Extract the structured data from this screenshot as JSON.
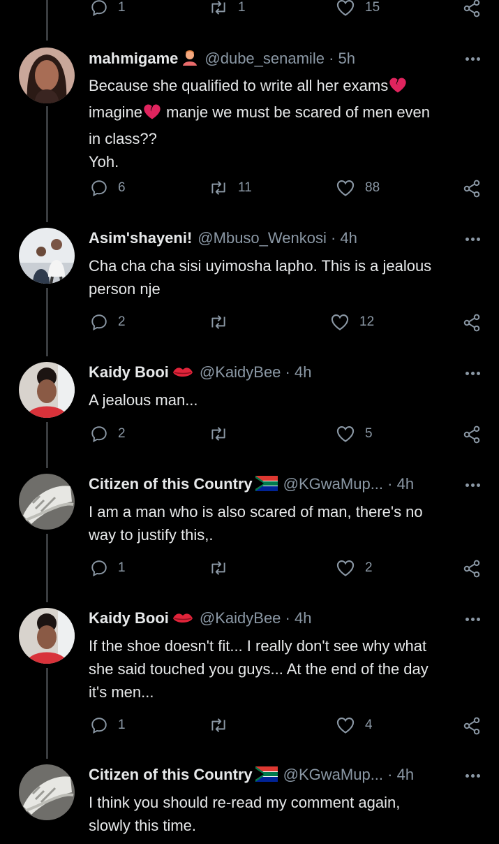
{
  "top_actions": {
    "replies": "1",
    "retweets": "1",
    "likes": "15"
  },
  "tweets": [
    {
      "name": "mahmigame",
      "handle": "@dube_senamile",
      "time": "· 5h",
      "lines": [
        "Because she qualified to write all her exams",
        "imagine",
        "manje we must be scared of men even",
        "in class??",
        "Yoh."
      ],
      "replies": "6",
      "retweets": "11",
      "likes": "88",
      "avatar": "woman-portrait"
    },
    {
      "name": "Asim'shayeni!",
      "handle": "@Mbuso_Wenkosi",
      "time": "· 4h",
      "lines": [
        "Cha cha cha sisi uyimosha lapho. This is a jealous",
        "person nje"
      ],
      "replies": "2",
      "retweets": "",
      "likes": "12",
      "avatar": "group-photo"
    },
    {
      "name": "Kaidy Booi",
      "handle": "@KaidyBee",
      "time": "· 4h",
      "lines": [
        "A jealous man..."
      ],
      "replies": "2",
      "retweets": "",
      "likes": "5",
      "avatar": "woman-red-top"
    },
    {
      "name": "Citizen of this Country",
      "handle": "@KGwaMup...",
      "time": "· 4h",
      "lines": [
        "I am a man who is also scared of man, there's no",
        "way to justify this,."
      ],
      "replies": "1",
      "retweets": "",
      "likes": "2",
      "avatar": "sneaker"
    },
    {
      "name": "Kaidy Booi",
      "handle": "@KaidyBee",
      "time": "· 4h",
      "lines": [
        "If the shoe doesn't fit... I really don't see why what",
        "she said touched you guys... At the end of the day",
        "it's men..."
      ],
      "replies": "1",
      "retweets": "",
      "likes": "4",
      "avatar": "woman-red-top"
    },
    {
      "name": "Citizen of this Country",
      "handle": "@KGwaMup...",
      "time": "· 4h",
      "lines": [
        "I think you should re-read my comment again,",
        "slowly this time."
      ],
      "avatar": "sneaker"
    }
  ],
  "colors": {
    "background": "#000000",
    "text": "#e7e9ea",
    "muted": "#8b98a5",
    "thread": "#3a3d40",
    "broken_heart": "#e0245e"
  }
}
